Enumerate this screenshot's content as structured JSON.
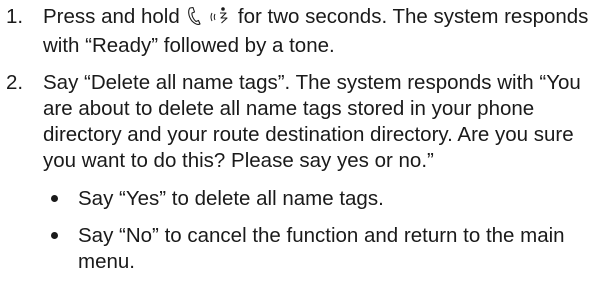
{
  "instructions": {
    "steps": [
      {
        "number": "1.",
        "text_before_icons": "Press and hold",
        "icons": [
          "phone-handset-icon",
          "voice-recognition-icon"
        ],
        "text_after_icons": "for two seconds. The system responds with “Ready” followed by a tone."
      },
      {
        "number": "2.",
        "text": "Say “Delete all name tags”. The system responds with “You are about to delete all name tags stored in your phone directory and your route destination directory. Are you sure you want to do this? Please say yes or no.”",
        "bullets": [
          "Say “Yes” to delete all name tags.",
          "Say “No” to cancel the function and return to the main menu."
        ]
      }
    ]
  }
}
